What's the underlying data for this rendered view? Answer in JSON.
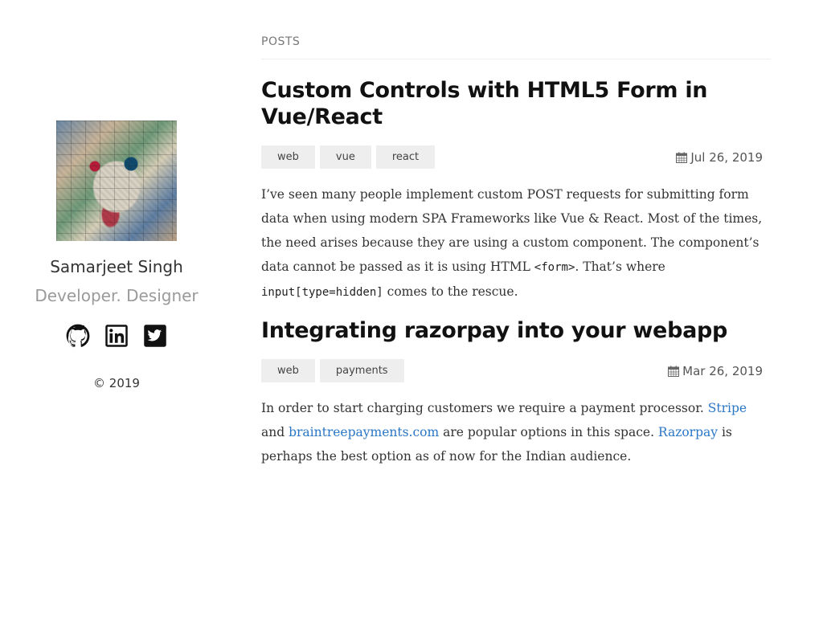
{
  "sidebar": {
    "name": "Samarjeet Singh",
    "tagline": "Developer. Designer",
    "social": [
      {
        "label": "GitHub",
        "icon": "github-icon"
      },
      {
        "label": "LinkedIn",
        "icon": "linkedin-icon"
      },
      {
        "label": "Twitter",
        "icon": "twitter-icon"
      }
    ],
    "copyright": "© 2019"
  },
  "main": {
    "section_label": "POSTS",
    "posts": [
      {
        "title": "Custom Controls with HTML5 Form in Vue/React",
        "tags": [
          "web",
          "vue",
          "react"
        ],
        "date": "Jul 26, 2019",
        "excerpt": {
          "text1": "I’ve seen many people implement custom POST requests for submitting form data when using modern SPA Frameworks like Vue & React. Most of the times, the need arises because they are using a custom component. The component’s data cannot be passed as it is using HTML ",
          "code1": "<form>",
          "text2": ". That’s where ",
          "code2": "input[type=hidden]",
          "text3": " comes to the rescue."
        }
      },
      {
        "title": "Integrating razorpay into your webapp",
        "tags": [
          "web",
          "payments"
        ],
        "date": "Mar 26, 2019",
        "excerpt": {
          "text1": "In order to start charging customers we require a payment processor. ",
          "link1": "Stripe",
          "text2": " and ",
          "link2": "braintreepayments.com",
          "text3": " are popular options in this space. ",
          "link3": "Razorpay",
          "text4": " is perhaps the best option as of now for the Indian audience."
        }
      }
    ]
  },
  "colors": {
    "link": "#2a76c6",
    "tag_bg": "#eeeeee",
    "muted": "#9a9a9a"
  }
}
